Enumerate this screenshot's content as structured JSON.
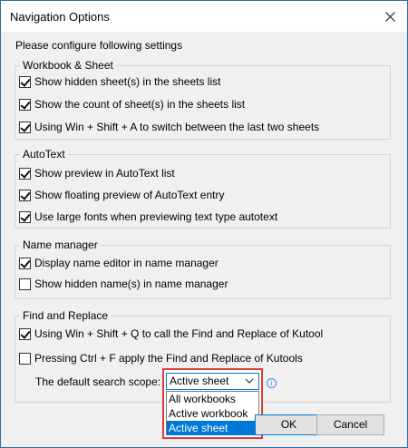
{
  "window": {
    "title": "Navigation Options"
  },
  "prompt": "Please configure following settings",
  "groups": {
    "workbook": {
      "label": "Workbook & Sheet",
      "items": [
        {
          "label": "Show hidden sheet(s) in the sheets list",
          "checked": true
        },
        {
          "label": "Show the count of sheet(s) in the sheets list",
          "checked": true
        },
        {
          "label": "Using Win + Shift + A to switch between the last two sheets",
          "checked": true
        }
      ]
    },
    "autotext": {
      "label": "AutoText",
      "items": [
        {
          "label": "Show preview in AutoText list",
          "checked": true
        },
        {
          "label": "Show floating preview of AutoText entry",
          "checked": true
        },
        {
          "label": "Use large fonts when previewing text type autotext",
          "checked": true
        }
      ]
    },
    "namemanager": {
      "label": "Name manager",
      "items": [
        {
          "label": "Display name editor in name manager",
          "checked": true
        },
        {
          "label": "Show hidden name(s) in name manager",
          "checked": false
        }
      ]
    },
    "findreplace": {
      "label": "Find and Replace",
      "items": [
        {
          "label": "Using Win + Shift + Q to call the Find and Replace of Kutool",
          "checked": true
        },
        {
          "label": "Pressing Ctrl + F apply the Find and Replace of Kutools",
          "checked": false
        }
      ],
      "scope_label": "The default search scope:",
      "scope_value": "Active sheet",
      "scope_options": [
        "All workbooks",
        "Active workbook",
        "Active sheet"
      ]
    }
  },
  "buttons": {
    "ok": "OK",
    "cancel": "Cancel"
  },
  "colors": {
    "accent": "#0078d7",
    "highlight_border": "#e23b3b"
  }
}
